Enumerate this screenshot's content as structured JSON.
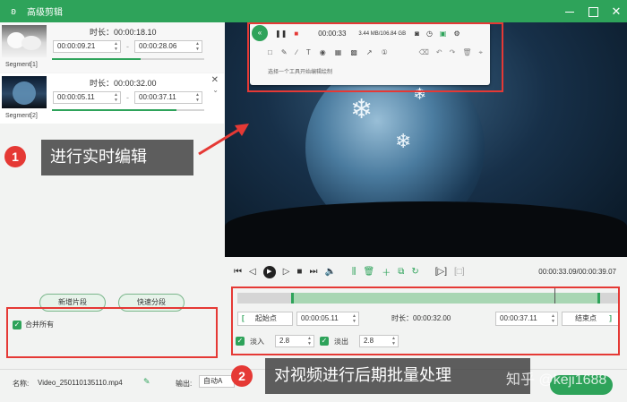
{
  "window": {
    "title": "高级剪辑",
    "logo": "rabbit-logo-icon"
  },
  "segments": [
    {
      "label": "Segment[1]",
      "duration": "时长：00:00:18.10",
      "start": "00:00:09.21",
      "end": "00:00:28.06",
      "progress": 0.58
    },
    {
      "label": "Segment[2]",
      "duration": "时长：00:00:32.00",
      "start": "00:00:05.11",
      "end": "00:00:37.11",
      "progress": 0.82
    }
  ],
  "left_buttons": {
    "new_segment": "新增片段",
    "quick_split": "快速分段",
    "merge_all": "合并所有"
  },
  "bottom": {
    "name_label": "名称:",
    "file_name": "Video_250110135110.mp4",
    "output_label": "输出:",
    "output_value": "自动A",
    "export_label": ""
  },
  "recorder": {
    "time": "00:00:33",
    "size": "3.44 MB/106.84 GB",
    "hint": "选择一个工具开始编辑绘制"
  },
  "player": {
    "time_display": "00:00:33.09/00:00:39.07"
  },
  "trim": {
    "start_btn": "起始点",
    "start_value": "00:00:05.11",
    "duration_label": "时长：00:00:32.00",
    "end_value": "00:00:37.11",
    "end_btn": "结束点",
    "selection_start": 0.14,
    "selection_end": 0.95,
    "playhead": 0.83
  },
  "fade": {
    "in_label": "淡入",
    "in_value": "2.8",
    "out_label": "淡出",
    "out_value": "2.8"
  },
  "annotations": {
    "callout1_num": "1",
    "callout1_text": "进行实时编辑",
    "callout2_num": "2",
    "callout2_text": "对视频进行后期批量处理"
  },
  "watermark": "知乎 @keji1688"
}
